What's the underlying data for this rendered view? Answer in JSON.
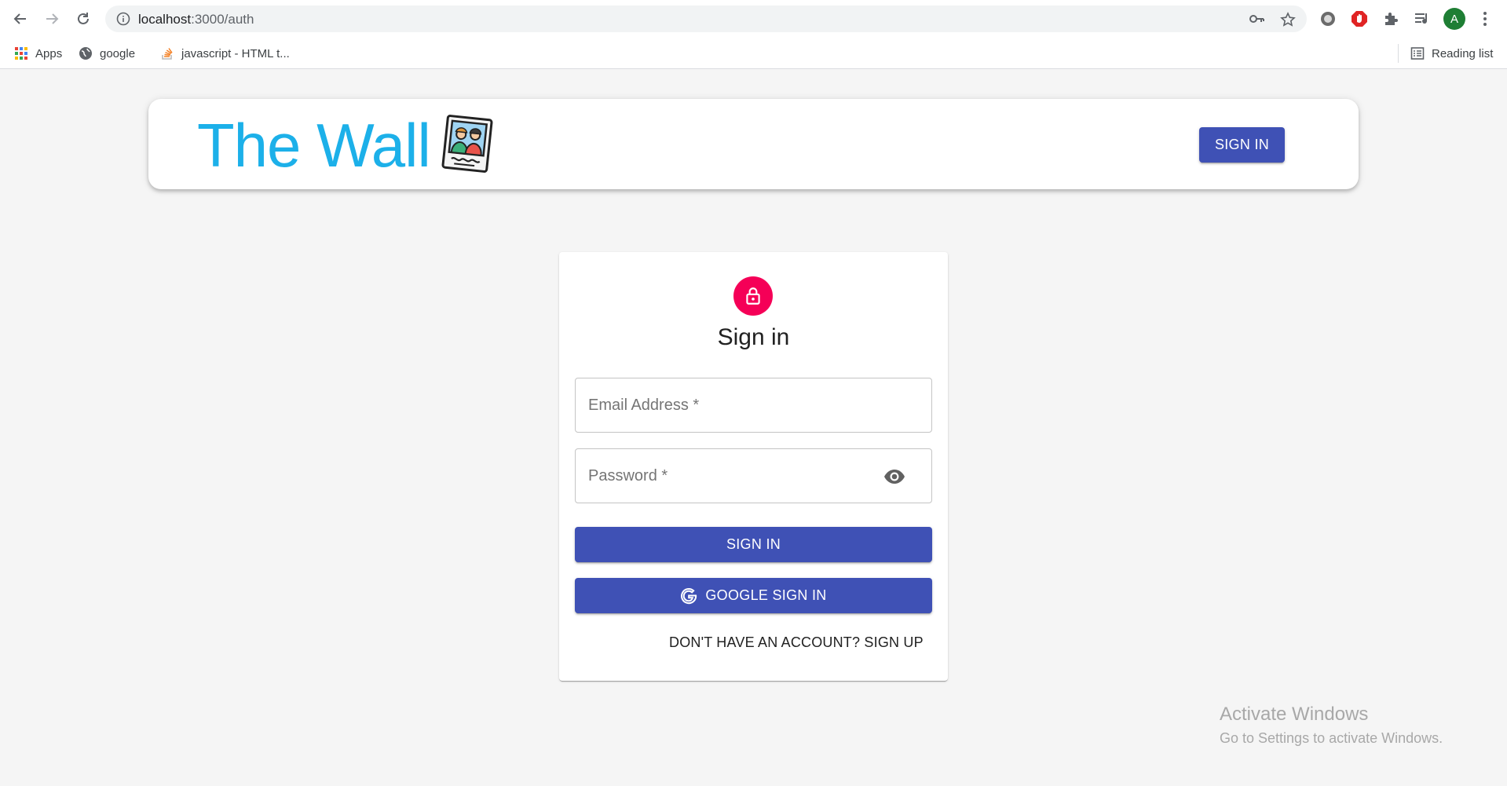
{
  "browser": {
    "url_host": "localhost",
    "url_path": ":3000/auth",
    "profile_initial": "A",
    "bookmarks": [
      {
        "label": "Apps",
        "icon": "apps-grid-icon"
      },
      {
        "label": "google",
        "icon": "globe-icon"
      },
      {
        "label": "javascript - HTML t...",
        "icon": "stackoverflow-icon"
      }
    ],
    "reading_list": "Reading list"
  },
  "header": {
    "brand": "The Wall",
    "signin_label": "SIGN IN"
  },
  "signin": {
    "title": "Sign in",
    "email_placeholder": "Email Address *",
    "password_placeholder": "Password *",
    "submit_label": "SIGN IN",
    "google_label": "GOOGLE SIGN IN",
    "signup_link": "DON'T HAVE AN ACCOUNT? SIGN UP"
  },
  "watermark": {
    "title": "Activate Windows",
    "subtitle": "Go to Settings to activate Windows."
  },
  "colors": {
    "primary": "#3f51b5",
    "secondary": "#f50057",
    "brand": "#1cb0e9"
  }
}
